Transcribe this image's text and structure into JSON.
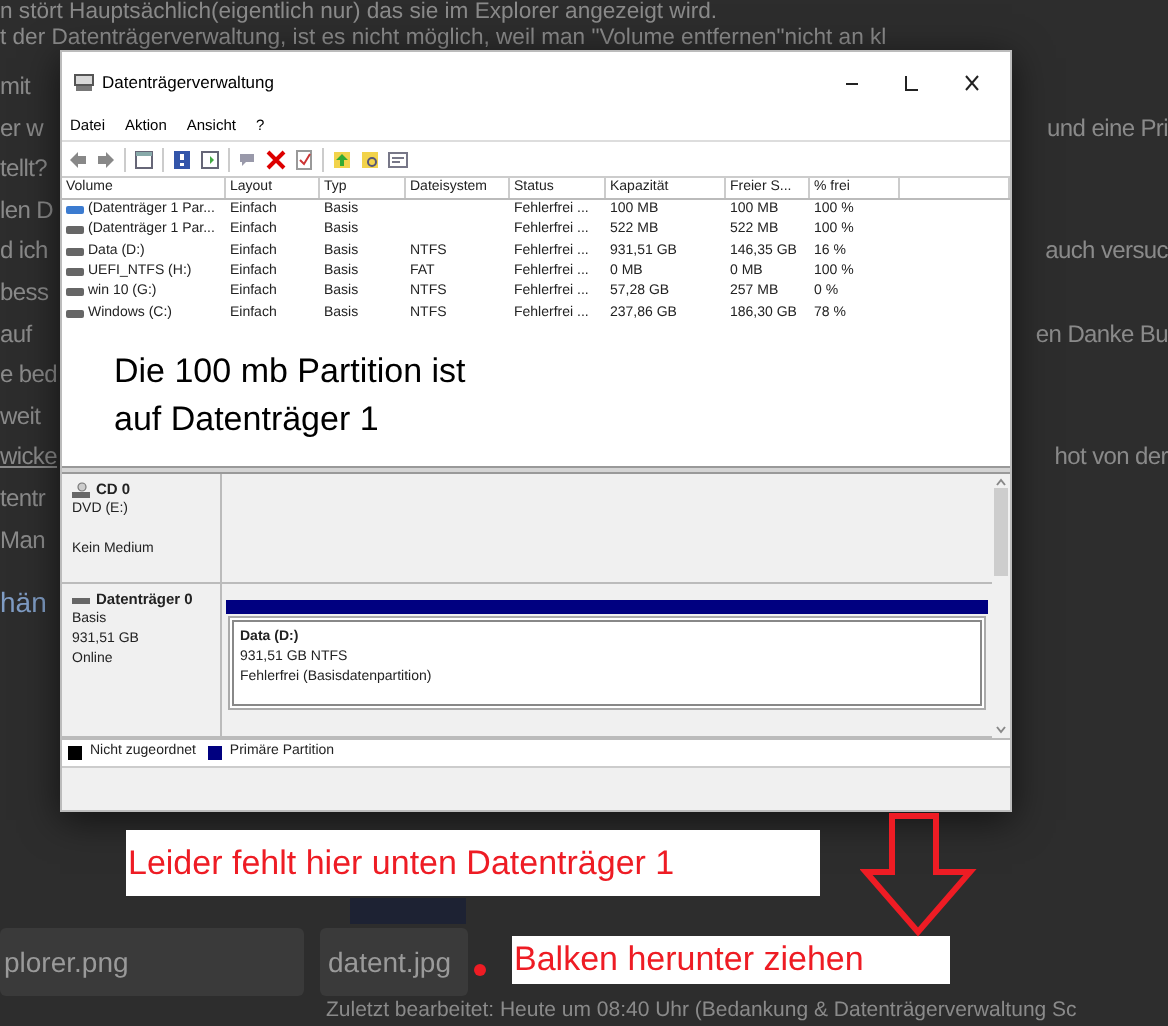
{
  "background_text": [
    {
      "left": "n stört Hauptsächlich(eigentlich nur) das sie im Explorer angezeigt wird.",
      "kind": "text"
    },
    {
      "left": "t der Datenträgerverwaltung, ist es nicht möglich, weil man \"Volume entfernen\"nicht an kl",
      "kind": "text"
    },
    {
      "left": "mit",
      "kind": "text"
    },
    {
      "left": "er w",
      "right": "und eine Pri",
      "kind": "text"
    },
    {
      "left": "tellt?",
      "kind": "text"
    },
    {
      "left": "len D",
      "kind": "text"
    },
    {
      "left": "d ich",
      "right": "auch versuc",
      "kind": "text"
    },
    {
      "left": "bess",
      "kind": "text"
    },
    {
      "left": "auf",
      "right": "en Danke Bu",
      "kind": "text"
    },
    {
      "left": "e bed",
      "kind": "text"
    },
    {
      "left": "weit",
      "kind": "text"
    },
    {
      "left": "wicke",
      "right": "hot von der",
      "kind": "link"
    },
    {
      "left": "tentr",
      "kind": "text"
    },
    {
      "left": "Man",
      "kind": "text"
    }
  ],
  "section_link": "hän",
  "attachments": [
    {
      "name": "plorer.png"
    },
    {
      "name": "datent.jpg"
    }
  ],
  "edit_note": "Zuletzt bearbeitet: Heute um 08:40 Uhr (Bedankung & Datenträgerverwaltung Sc",
  "window": {
    "title": "Datenträgerverwaltung",
    "menu": [
      "Datei",
      "Aktion",
      "Ansicht",
      "?"
    ],
    "table": {
      "columns": [
        "Volume",
        "Layout",
        "Typ",
        "Dateisystem",
        "Status",
        "Kapazität",
        "Freier S...",
        "% frei"
      ],
      "rows": [
        [
          "(Datenträger 1 Par...",
          "Einfach",
          "Basis",
          "",
          "Fehlerfrei ...",
          "100 MB",
          "100 MB",
          "100 %"
        ],
        [
          "(Datenträger 1 Par...",
          "Einfach",
          "Basis",
          "",
          "Fehlerfrei ...",
          "522 MB",
          "522 MB",
          "100 %"
        ],
        [
          "Data (D:)",
          "Einfach",
          "Basis",
          "NTFS",
          "Fehlerfrei ...",
          "931,51 GB",
          "146,35 GB",
          "16 %"
        ],
        [
          "UEFI_NTFS (H:)",
          "Einfach",
          "Basis",
          "FAT",
          "Fehlerfrei ...",
          "0 MB",
          "0 MB",
          "100 %"
        ],
        [
          "win 10 (G:)",
          "Einfach",
          "Basis",
          "NTFS",
          "Fehlerfrei ...",
          "57,28 GB",
          "257 MB",
          "0 %"
        ],
        [
          "Windows (C:)",
          "Einfach",
          "Basis",
          "NTFS",
          "Fehlerfrei ...",
          "237,86 GB",
          "186,30 GB",
          "78 %"
        ]
      ]
    },
    "overlay_note": "Die 100 mb Partition ist\nauf Datenträger 1",
    "disks": [
      {
        "kind": "cdrom",
        "name": "CD 0",
        "type": "DVD (E:)",
        "status": "Kein Medium"
      },
      {
        "kind": "disk",
        "name": "Datenträger 0",
        "type": "Basis",
        "size": "931,51 GB",
        "status": "Online",
        "partition": {
          "title": "Data  (D:)",
          "size": "931,51 GB NTFS",
          "status": "Fehlerfrei (Basisdatenpartition)",
          "color": "#000080"
        }
      }
    ],
    "legend": [
      {
        "label": "Nicht zugeordnet",
        "color": "#000000"
      },
      {
        "label": "Primäre Partition",
        "color": "#000080"
      }
    ]
  },
  "callouts": [
    "Leider fehlt hier unten Datenträger 1",
    "Balken herunter ziehen"
  ]
}
